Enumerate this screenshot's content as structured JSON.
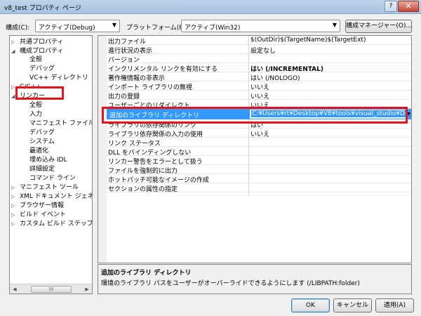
{
  "window": {
    "title": "v8_test プロパティ ページ",
    "help_label": "?",
    "close_label": "✕"
  },
  "config_bar": {
    "config_label": "構成(C):",
    "config_value": "アクティブ(Debug)",
    "platform_label": "プラットフォーム(P):",
    "platform_value": "アクティブ(Win32)",
    "manager_button": "構成マネージャー(O)..."
  },
  "tree": {
    "items": [
      {
        "label": "共通プロパティ",
        "twist": "▷"
      },
      {
        "label": "構成プロパティ",
        "twist": "◢"
      },
      {
        "label": "全般"
      },
      {
        "label": "デバッグ"
      },
      {
        "label": "VC++ ディレクトリ"
      },
      {
        "label": "C/C++",
        "twist": "▷"
      },
      {
        "label": "リンカー",
        "twist": "◢"
      },
      {
        "label": "全般"
      },
      {
        "label": "入力"
      },
      {
        "label": "マニフェスト ファイル"
      },
      {
        "label": "デバッグ"
      },
      {
        "label": "システム"
      },
      {
        "label": "最適化"
      },
      {
        "label": "埋め込み IDL"
      },
      {
        "label": "詳細設定"
      },
      {
        "label": "コマンド ライン"
      },
      {
        "label": "マニフェスト ツール",
        "twist": "▷"
      },
      {
        "label": "XML ドキュメント ジェネ",
        "twist": "▷"
      },
      {
        "label": "ブラウザー情報",
        "twist": "▷"
      },
      {
        "label": "ビルド イベント",
        "twist": "▷"
      },
      {
        "label": "カスタム ビルド ステップ",
        "twist": "▷"
      }
    ],
    "scroll_left": "◀",
    "scroll_right": "▶",
    "scroll_thumb": "III"
  },
  "grid": {
    "rows": [
      {
        "name": "出力ファイル",
        "value": "$(OutDir)$(TargetName)$(TargetExt)"
      },
      {
        "name": "進行状況の表示",
        "value": "設定なし"
      },
      {
        "name": "バージョン",
        "value": ""
      },
      {
        "name": "インクリメンタル リンクを有効にする",
        "value": "はい (/INCREMENTAL)",
        "bold": true
      },
      {
        "name": "著作権情報の非表示",
        "value": "はい (/NOLOGO)"
      },
      {
        "name": "インポート ライブラリの無視",
        "value": "いいえ"
      },
      {
        "name": "出力の登録",
        "value": "いいえ"
      },
      {
        "name": "ユーザーごとのリダイレクト",
        "value": "いいえ"
      },
      {
        "name": "追加のライブラリ ディレクトリ",
        "value": "C:¥Users¥rt¥Desktop¥V8¥tools¥visual_studio¥Debug"
      },
      {
        "name": "ライブラリの依存関係のリンク",
        "value": "はい"
      },
      {
        "name": "ライブラリ依存関係の入力の使用",
        "value": "いいえ"
      },
      {
        "name": "リンク ステータス",
        "value": ""
      },
      {
        "name": "DLL をバインディングしない",
        "value": ""
      },
      {
        "name": "リンカー警告をエラーとして扱う",
        "value": ""
      },
      {
        "name": "ファイルを強制的に出力",
        "value": ""
      },
      {
        "name": "ホットパッチ可能なイメージの作成",
        "value": ""
      },
      {
        "name": "セクションの属性の指定",
        "value": ""
      }
    ],
    "selected_index": 8,
    "dropdown_glyph": "▼"
  },
  "description": {
    "title": "追加のライブラリ ディレクトリ",
    "text": "環境のライブラリ パスをユーザーがオーバーライドできるようにします (/LIBPATH:folder)"
  },
  "buttons": {
    "ok": "OK",
    "cancel": "キャンセル",
    "apply": "適用(A)"
  },
  "annotation_color": "#e8141b"
}
